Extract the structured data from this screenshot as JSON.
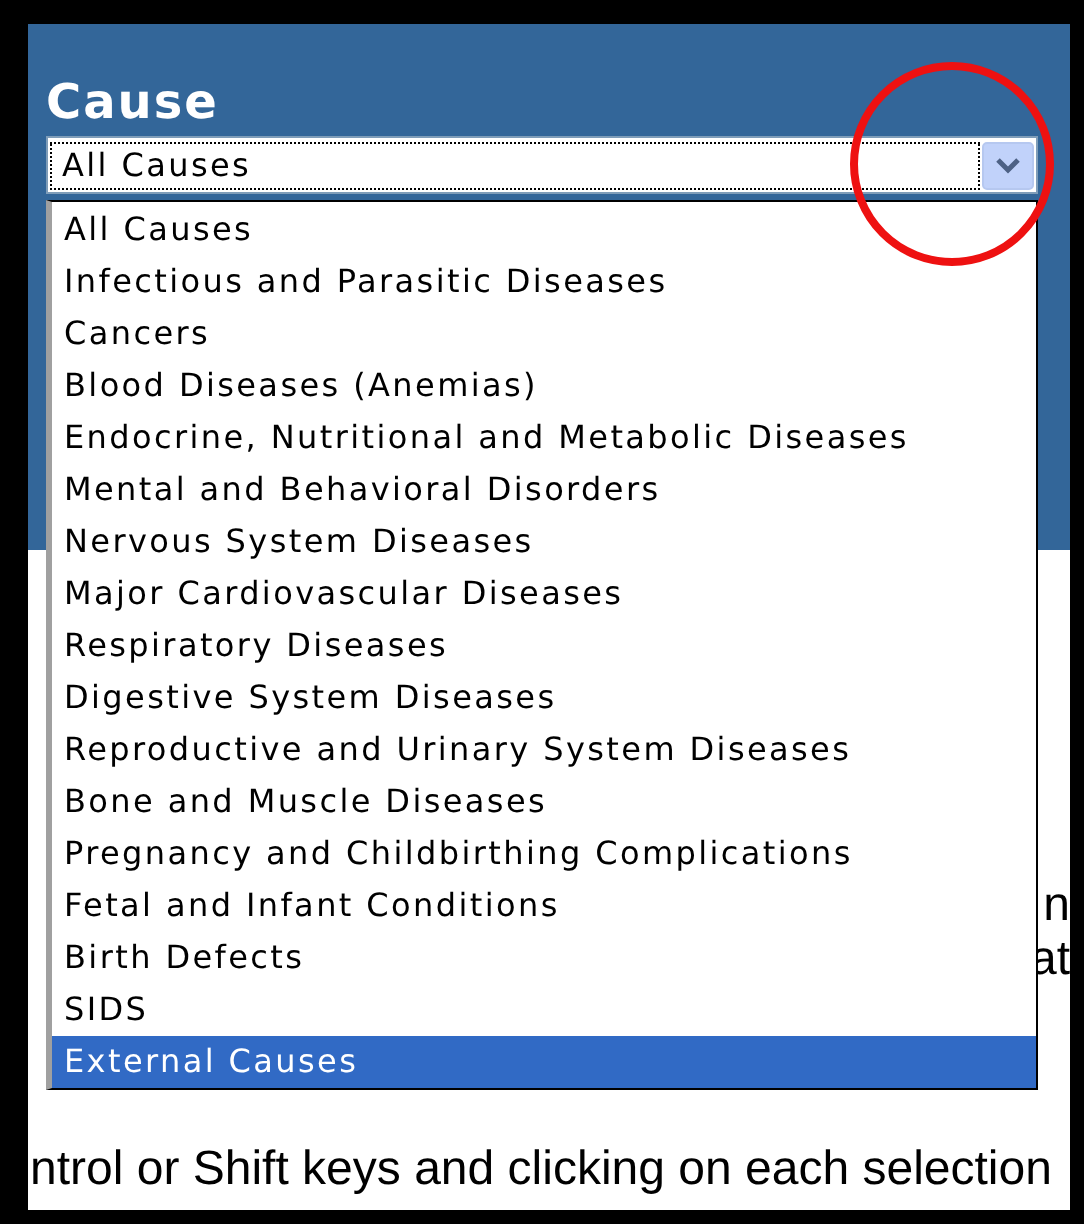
{
  "panel": {
    "heading": "Cause"
  },
  "select": {
    "value": "All Causes"
  },
  "options": [
    {
      "label": "All Causes",
      "selected": false
    },
    {
      "label": "Infectious and Parasitic Diseases",
      "selected": false
    },
    {
      "label": "Cancers",
      "selected": false
    },
    {
      "label": "Blood Diseases (Anemias)",
      "selected": false
    },
    {
      "label": "Endocrine, Nutritional and Metabolic Diseases",
      "selected": false
    },
    {
      "label": "Mental and Behavioral Disorders",
      "selected": false
    },
    {
      "label": "Nervous System Diseases",
      "selected": false
    },
    {
      "label": "Major Cardiovascular Diseases",
      "selected": false
    },
    {
      "label": "Respiratory Diseases",
      "selected": false
    },
    {
      "label": "Digestive System Diseases",
      "selected": false
    },
    {
      "label": "Reproductive and Urinary System Diseases",
      "selected": false
    },
    {
      "label": "Bone and Muscle Diseases",
      "selected": false
    },
    {
      "label": "Pregnancy and Childbirthing Complications",
      "selected": false
    },
    {
      "label": "Fetal and Infant Conditions",
      "selected": false
    },
    {
      "label": "Birth Defects",
      "selected": false
    },
    {
      "label": "SIDS",
      "selected": false
    },
    {
      "label": "External Causes",
      "selected": true
    }
  ],
  "background_fragments": [
    "n",
    "at"
  ],
  "instruction": "ntrol or Shift keys and clicking on each selection"
}
